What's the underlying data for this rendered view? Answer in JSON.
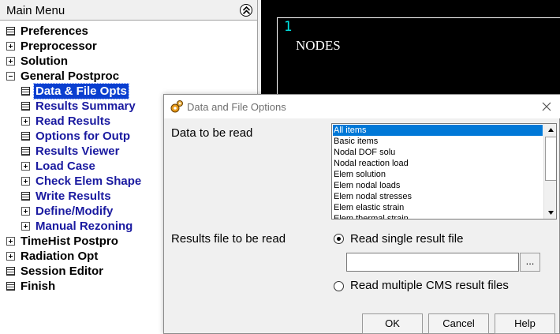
{
  "main_menu": {
    "title": "Main Menu",
    "items": [
      {
        "label": "Preferences",
        "icon": "doc",
        "level": 0
      },
      {
        "label": "Preprocessor",
        "icon": "expand",
        "level": 0
      },
      {
        "label": "Solution",
        "icon": "expand",
        "level": 0
      },
      {
        "label": "General Postproc",
        "icon": "collapse",
        "level": 0
      },
      {
        "label": "Data & File Opts",
        "icon": "doc",
        "level": 1,
        "selected": true
      },
      {
        "label": "Results Summary",
        "icon": "doc",
        "level": 1
      },
      {
        "label": "Read Results",
        "icon": "expand",
        "level": 1
      },
      {
        "label": "Options for Outp",
        "icon": "doc",
        "level": 1
      },
      {
        "label": "Results Viewer",
        "icon": "doc",
        "level": 1
      },
      {
        "label": "Load Case",
        "icon": "expand",
        "level": 1
      },
      {
        "label": "Check Elem Shape",
        "icon": "expand",
        "level": 1
      },
      {
        "label": "Write Results",
        "icon": "doc",
        "level": 1
      },
      {
        "label": "Define/Modify",
        "icon": "expand",
        "level": 1
      },
      {
        "label": "Manual Rezoning",
        "icon": "expand",
        "level": 1
      },
      {
        "label": "TimeHist Postpro",
        "icon": "expand",
        "level": 0
      },
      {
        "label": "Radiation Opt",
        "icon": "expand",
        "level": 0
      },
      {
        "label": "Session Editor",
        "icon": "doc",
        "level": 0
      },
      {
        "label": "Finish",
        "icon": "doc",
        "level": 0
      }
    ]
  },
  "graphics": {
    "window_number": "1",
    "plot_title": "NODES"
  },
  "dialog": {
    "title": "Data and File Options",
    "data_label": "Data to be read",
    "list_items": [
      "All items",
      "Basic items",
      "Nodal DOF solu",
      "Nodal reaction load",
      "Elem solution",
      "Elem nodal loads",
      "Elem nodal stresses",
      "Elem elastic strain",
      "Elem thermal strain"
    ],
    "list_selected": "All items",
    "results_label": "Results file to be read",
    "radio_single": "Read single result file",
    "radio_multiple": "Read multiple CMS result files",
    "file_path": "",
    "browse_label": "...",
    "ok": "OK",
    "cancel": "Cancel",
    "help": "Help"
  },
  "colors": {
    "selection": "#0a3fd0",
    "submenu_text": "#1a1aa0",
    "list_selection": "#0078d7",
    "graphics_bg": "#000000",
    "window_number": "#00e5e5"
  }
}
